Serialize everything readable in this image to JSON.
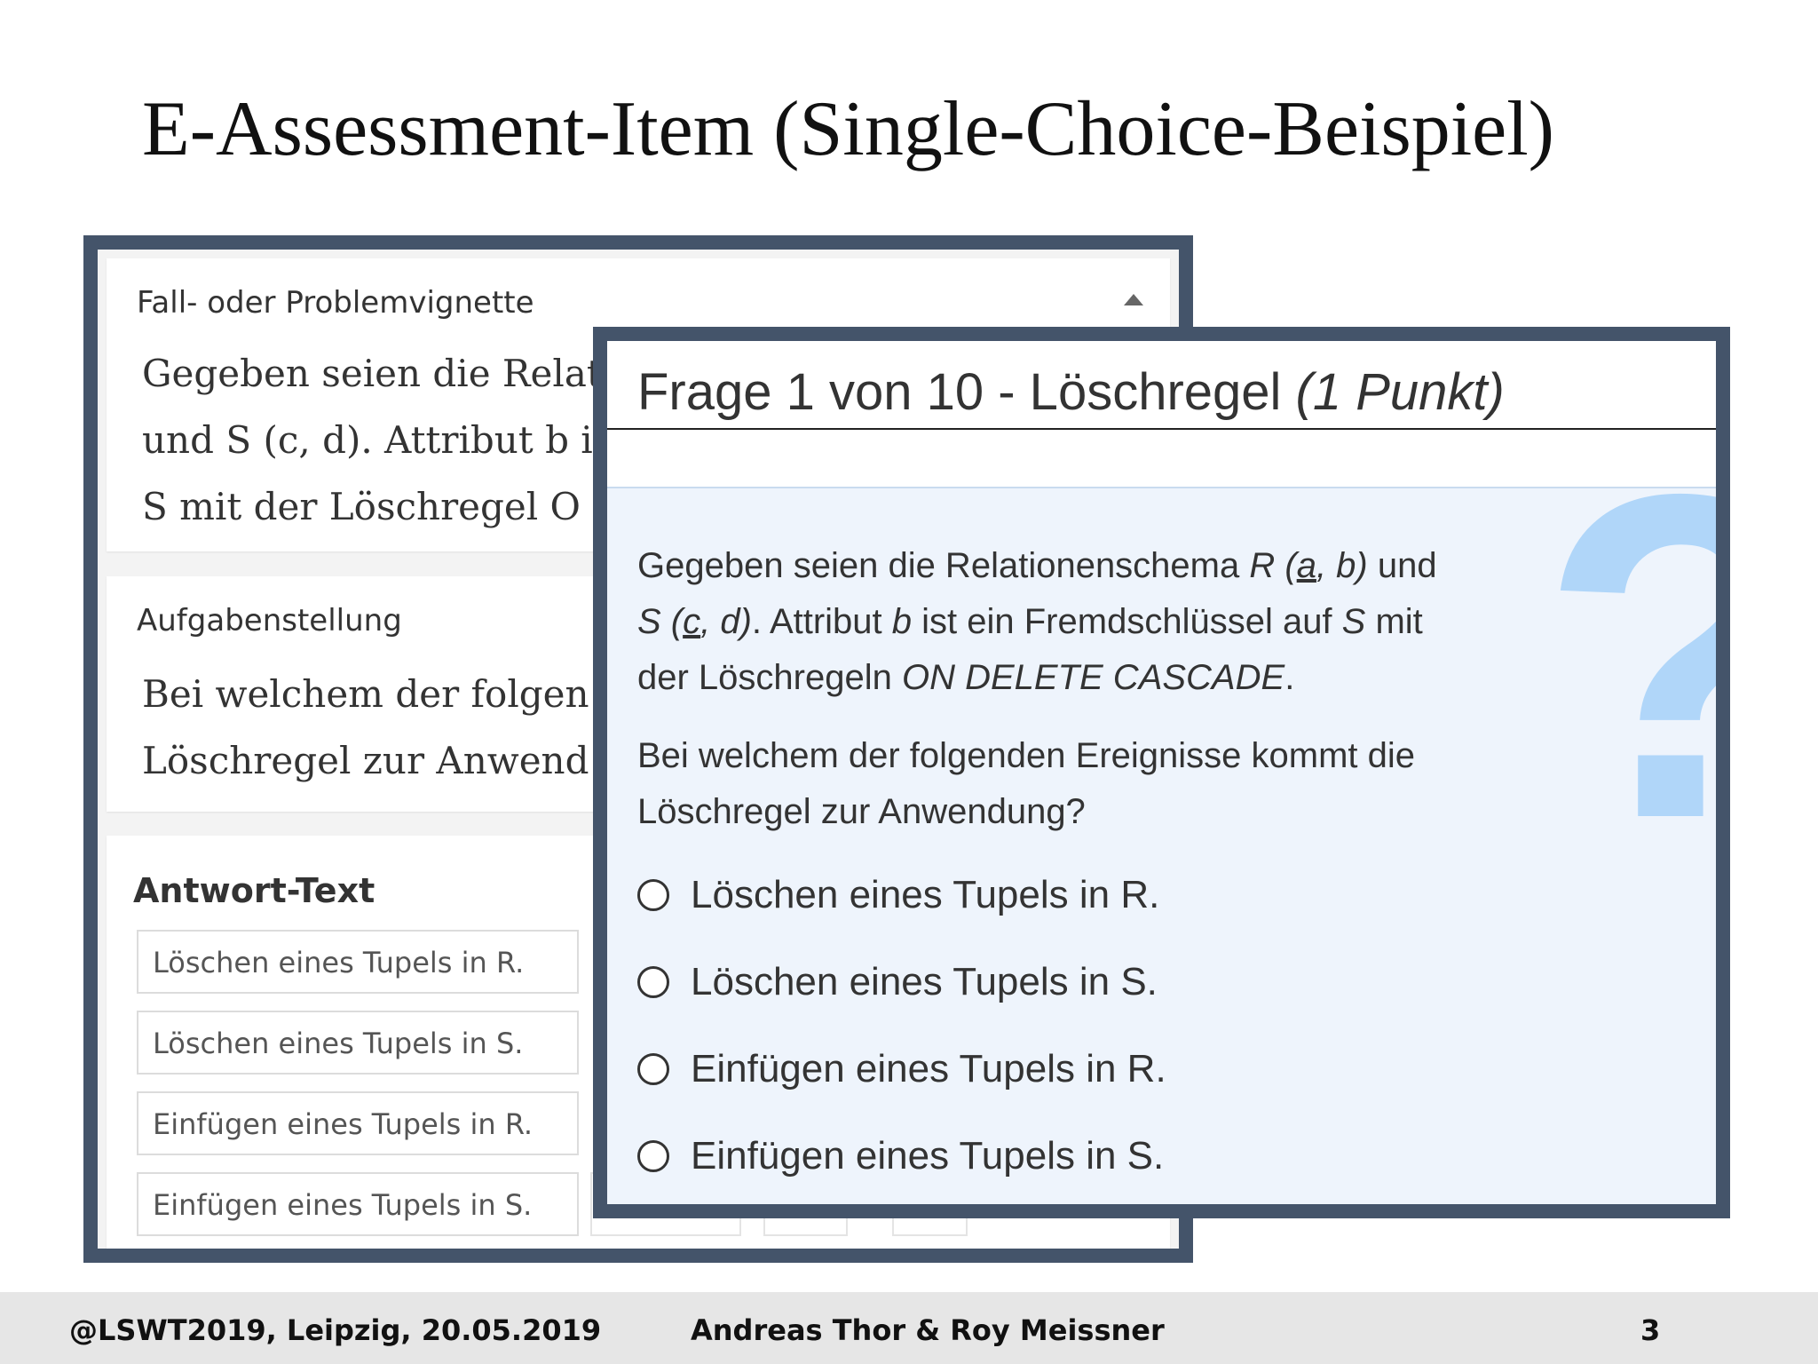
{
  "slide": {
    "title": "E-Assessment-Item (Single-Choice-Beispiel)"
  },
  "editor": {
    "vignette": {
      "header": "Fall- oder Problemvignette",
      "lines": [
        "Gegeben seien die Relat",
        "und S (c, d). Attribut b is",
        "S mit der Löschregel  O"
      ]
    },
    "task": {
      "header": "Aufgabenstellung",
      "lines": [
        "Bei welchem der folgen",
        "Löschregel zur Anwend"
      ]
    },
    "answers": {
      "header": "Antwort-Text",
      "items": [
        "Löschen eines Tupels in R.",
        "Löschen eines Tupels in S.",
        "Einfügen eines Tupels in R.",
        "Einfügen eines Tupels in S."
      ]
    }
  },
  "quiz": {
    "title_main": "Frage 1 von 10 - Löschregel ",
    "title_points": "(1 Punkt)",
    "decor_glyph": "?",
    "para1": {
      "l1a": "Gegeben seien die Relationenschema ",
      "l1b": "R (",
      "l1c": "a",
      "l1d": ", b)",
      "l1e": " und",
      "l2a": "S (",
      "l2b": "c",
      "l2c": ", d)",
      "l2d": ". Attribut ",
      "l2e": "b",
      "l2f": " ist ein Fremdschlüssel auf ",
      "l2g": "S",
      "l2h": " mit",
      "l3a": "der Löschregeln ",
      "l3b": "ON DELETE CASCADE",
      "l3c": "."
    },
    "para2": {
      "l1": "Bei welchem der folgenden Ereignisse kommt die",
      "l2": "Löschregel zur Anwendung?"
    },
    "options": [
      "Löschen eines Tupels in R.",
      "Löschen eines Tupels in S.",
      "Einfügen eines Tupels in R.",
      "Einfügen eines Tupels in S."
    ]
  },
  "footer": {
    "left": "@LSWT2019, Leipzig, 20.05.2019",
    "center": "Andreas Thor & Roy Meissner",
    "page": "3"
  },
  "colors": {
    "frame": "#44546a",
    "quiz_background": "#eef4fc",
    "question_mark": "#b0d6f9",
    "footer_background": "#e6e6e6"
  }
}
